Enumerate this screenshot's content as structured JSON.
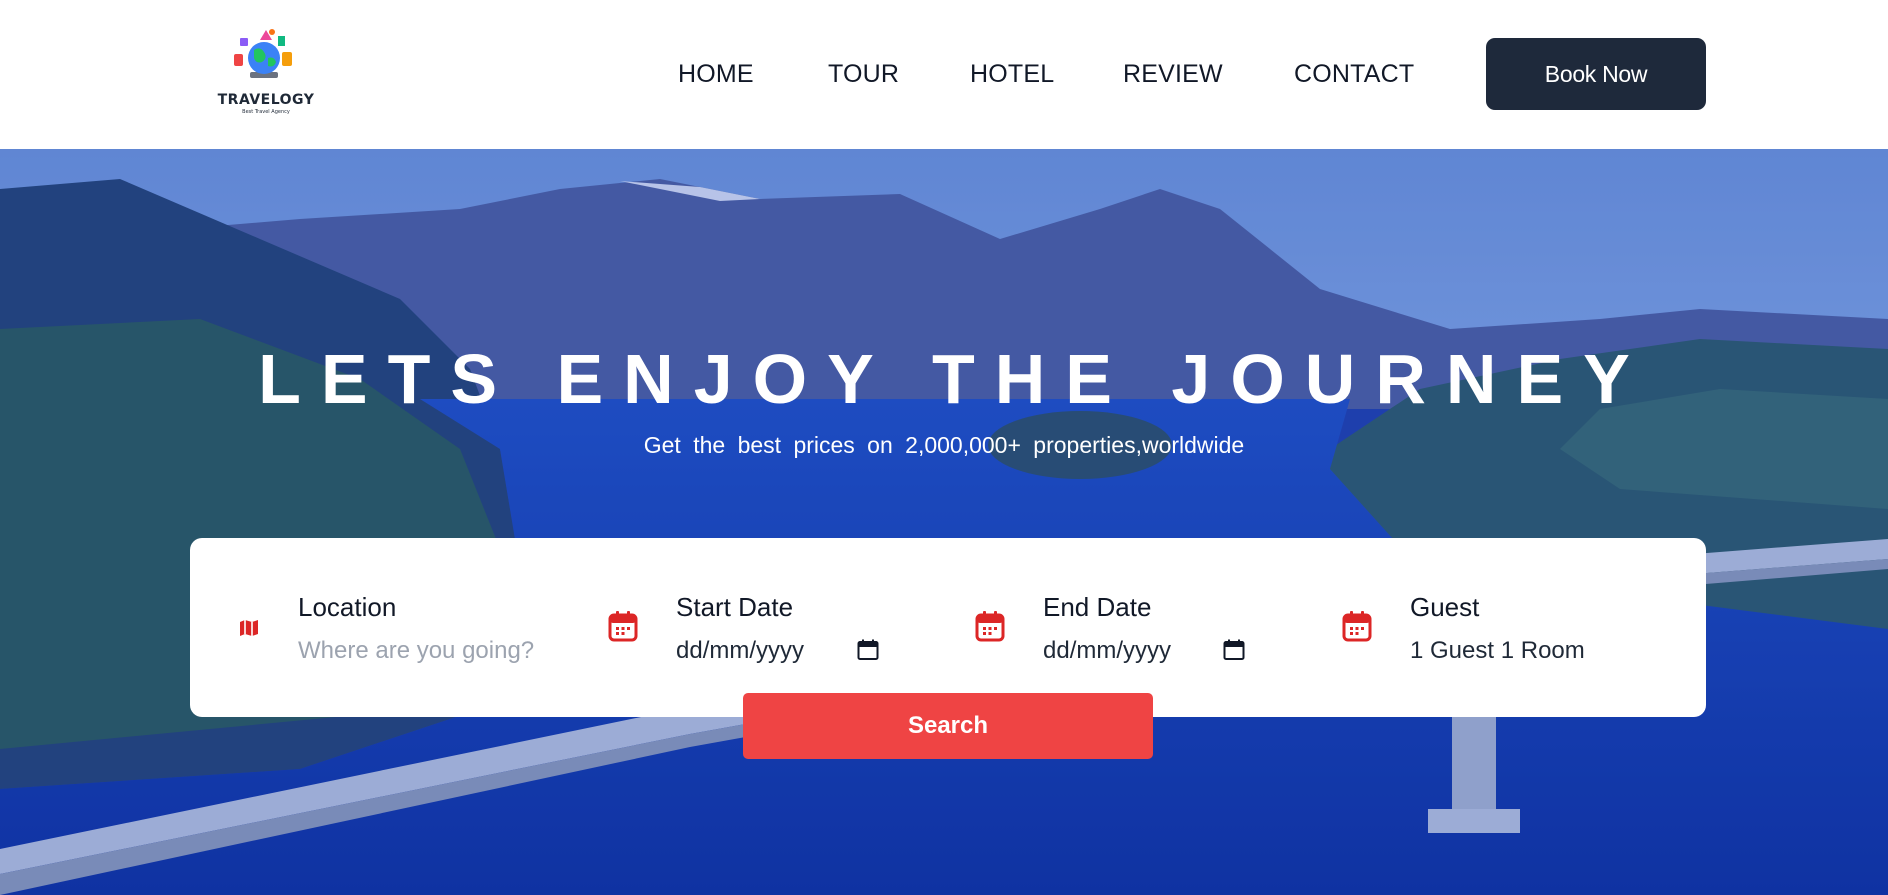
{
  "brand": {
    "name": "TRAVELOGY",
    "tagline": "Best Travel Agency"
  },
  "nav": {
    "home": "HOME",
    "tour": "TOUR",
    "hotel": "HOTEL",
    "review": "REVIEW",
    "contact": "CONTACT"
  },
  "header": {
    "cta_label": "Book Now"
  },
  "hero": {
    "title": "LETS ENJOY THE JOURNEY",
    "subtitle": "Get the best prices on 2,000,000+ properties,worldwide"
  },
  "search": {
    "location": {
      "label": "Location",
      "placeholder": "Where are you going?",
      "icon": "map-icon"
    },
    "start_date": {
      "label": "Start Date",
      "value": "dd/mm/yyyy",
      "icon": "calendar-icon"
    },
    "end_date": {
      "label": "End Date",
      "value": "dd/mm/yyyy",
      "icon": "calendar-icon"
    },
    "guest": {
      "label": "Guest",
      "value": "1 Guest 1 Room",
      "icon": "calendar-icon"
    },
    "button_label": "Search"
  },
  "colors": {
    "header_bg": "#ffffff",
    "cta_bg": "#1e293b",
    "accent_red": "#ef4444",
    "hero_tint": "#1f3fa8",
    "text_dark": "#111827"
  }
}
